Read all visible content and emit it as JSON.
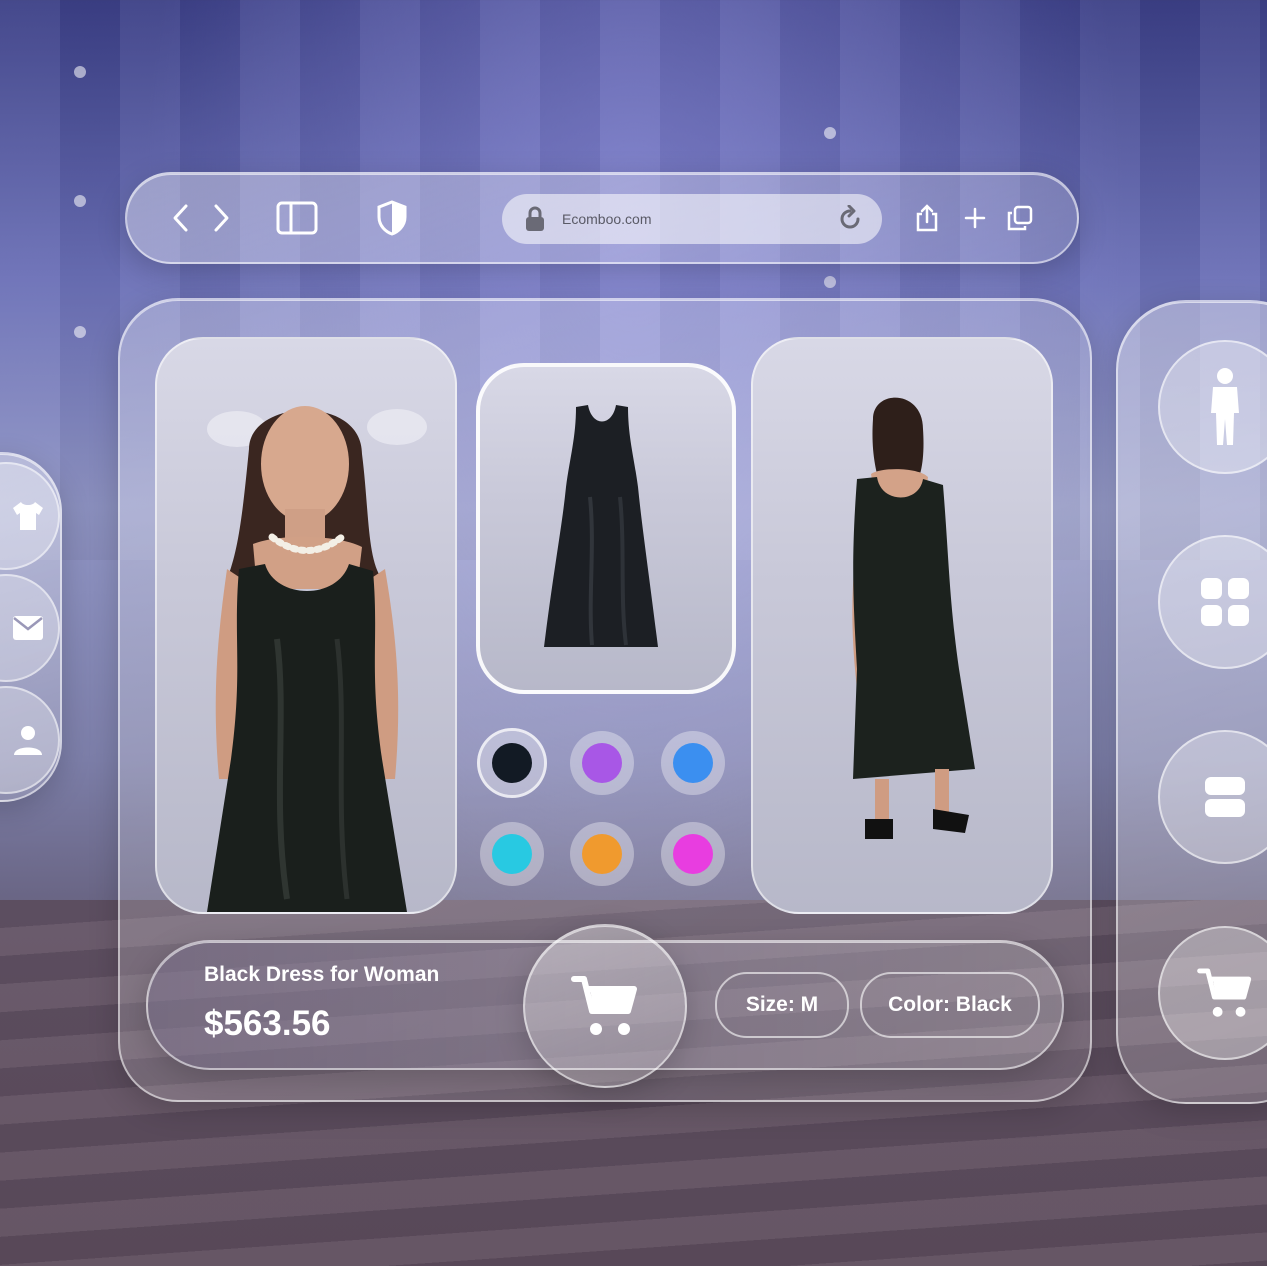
{
  "browser": {
    "url": "Ecomboo.com",
    "icons": [
      "chevron-left-icon",
      "chevron-right-icon",
      "sidebar-icon",
      "shield-icon",
      "lock-icon",
      "reload-icon",
      "share-icon",
      "plus-icon",
      "tabs-icon"
    ]
  },
  "product": {
    "name": "Black Dress for Woman",
    "price": "$563.56",
    "size_label": "Size: M",
    "color_label": "Color: Black"
  },
  "swatches": [
    {
      "name": "black",
      "color": "#121a24",
      "selected": true
    },
    {
      "name": "purple",
      "color": "#a857e6",
      "selected": false
    },
    {
      "name": "blue",
      "color": "#3b8ff0",
      "selected": false
    },
    {
      "name": "cyan",
      "color": "#28c9e2",
      "selected": false
    },
    {
      "name": "orange",
      "color": "#f09a2e",
      "selected": false
    },
    {
      "name": "magenta",
      "color": "#e83de0",
      "selected": false
    }
  ],
  "right_sidebar": {
    "icons": [
      "person-icon",
      "grid-icon",
      "list-icon",
      "cart-icon"
    ]
  },
  "left_sidebar": {
    "icons": [
      "shirt-icon",
      "mail-icon",
      "profile-icon"
    ]
  }
}
